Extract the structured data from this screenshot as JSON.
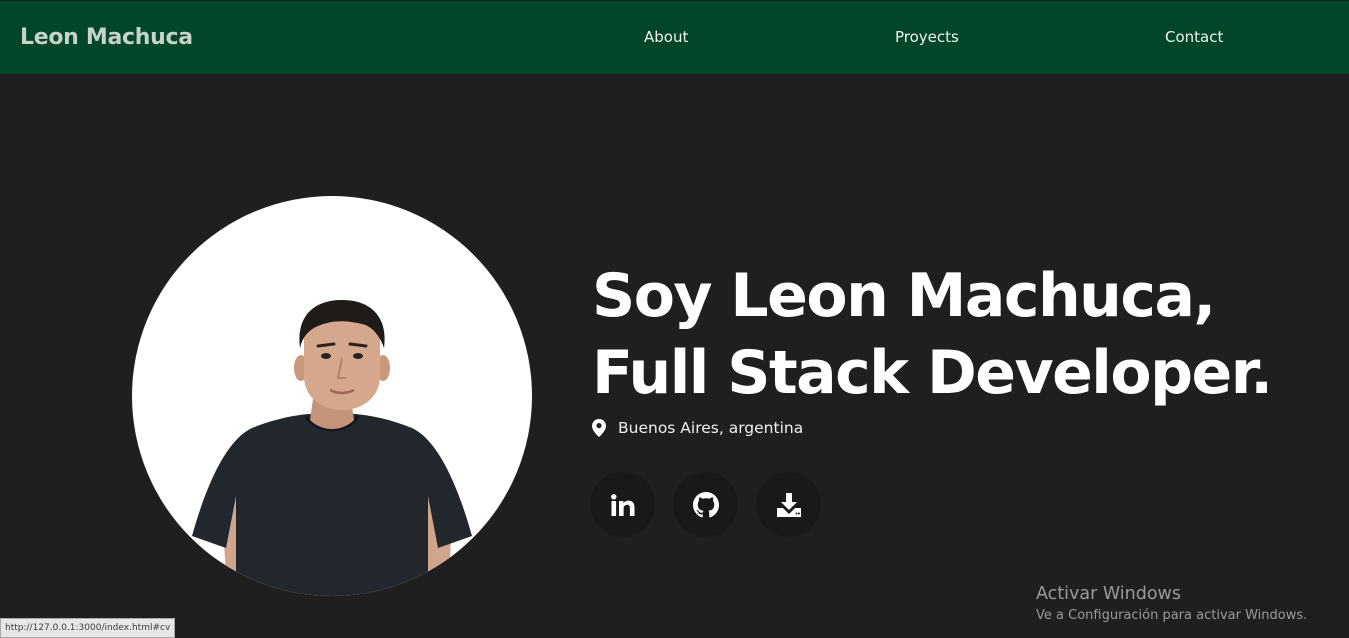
{
  "navbar": {
    "brand": "Leon Machuca",
    "links": [
      "About",
      "Proyects",
      "Contact"
    ],
    "background": "#014628"
  },
  "hero": {
    "title_line1": "Soy Leon Machuca,",
    "title_line2": "Full Stack Developer.",
    "location": "Buenos Aires, argentina",
    "location_icon": "map-pin-icon",
    "social": [
      {
        "icon": "linkedin-icon"
      },
      {
        "icon": "github-icon"
      },
      {
        "icon": "download-icon"
      }
    ]
  },
  "windows_activation": {
    "title": "Activar Windows",
    "subtitle": "Ve a Configuración para activar Windows."
  },
  "status_bar": {
    "url": "http://127.0.0.1:3000/index.html#cv"
  },
  "colors": {
    "page_background": "#201f20",
    "nav_background": "#014628",
    "social_button": "#1a191a"
  }
}
